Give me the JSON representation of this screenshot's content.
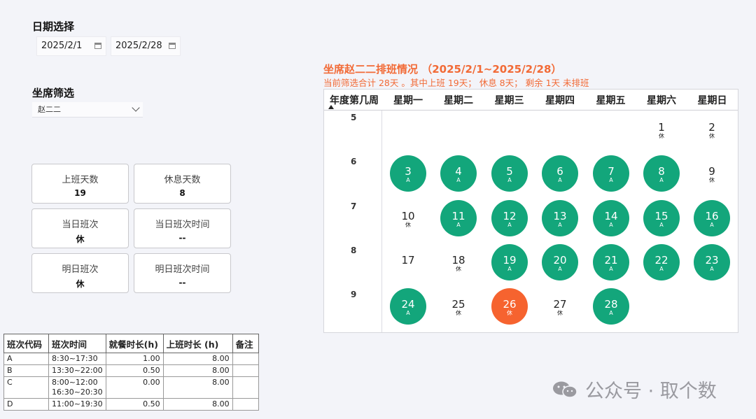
{
  "date_filter": {
    "title": "日期选择",
    "start": "2025/2/1",
    "end": "2025/2/28"
  },
  "seat_filter": {
    "title": "坐席筛选",
    "value": "赵二二"
  },
  "cards": [
    {
      "label": "上班天数",
      "value": "19"
    },
    {
      "label": "休息天数",
      "value": "8"
    },
    {
      "label": "当日班次",
      "value": "休"
    },
    {
      "label": "当日班次时间",
      "value": "--"
    },
    {
      "label": "明日班次",
      "value": "休"
    },
    {
      "label": "明日班次时间",
      "value": "--"
    }
  ],
  "shift_table": {
    "headers": [
      "班次代码",
      "班次时间",
      "就餐时长(h)",
      "上班时长 (h)",
      "备注"
    ],
    "rows": [
      {
        "code": "A",
        "time": "8:30~17:30",
        "meal": "1.00",
        "work": "8.00",
        "note": ""
      },
      {
        "code": "B",
        "time": "13:30~22:00",
        "meal": "0.50",
        "work": "8.00",
        "note": ""
      },
      {
        "code": "C",
        "time": "8:00~12:00",
        "time2": "16:30~20:30",
        "meal": "0.00",
        "work": "8.00",
        "note": ""
      },
      {
        "code": "D",
        "time": "11:00~19:30",
        "meal": "0.50",
        "work": "8.00",
        "note": ""
      }
    ]
  },
  "calendar": {
    "title": "坐席赵二二排班情况 （2025/2/1~2025/2/28）",
    "subtitle": "当前筛选合计 28天 。其中上班 19天； 休息 8天； 剩余 1天 未排班",
    "week_header": "年度第几周",
    "weekdays": [
      "星期一",
      "星期二",
      "星期三",
      "星期四",
      "星期五",
      "星期六",
      "星期日"
    ],
    "colors": {
      "work": "#13a67b",
      "today": "#f6632f",
      "rest": "#ffffff"
    },
    "weeks": [
      {
        "week": "5",
        "days": [
          {
            "day": "",
            "shift": "",
            "type": "empty"
          },
          {
            "day": "",
            "shift": "",
            "type": "empty"
          },
          {
            "day": "",
            "shift": "",
            "type": "empty"
          },
          {
            "day": "",
            "shift": "",
            "type": "empty"
          },
          {
            "day": "",
            "shift": "",
            "type": "empty"
          },
          {
            "day": "1",
            "shift": "休",
            "type": "rest"
          },
          {
            "day": "2",
            "shift": "休",
            "type": "rest"
          }
        ]
      },
      {
        "week": "6",
        "days": [
          {
            "day": "3",
            "shift": "A",
            "type": "work"
          },
          {
            "day": "4",
            "shift": "A",
            "type": "work"
          },
          {
            "day": "5",
            "shift": "A",
            "type": "work"
          },
          {
            "day": "6",
            "shift": "A",
            "type": "work"
          },
          {
            "day": "7",
            "shift": "A",
            "type": "work"
          },
          {
            "day": "8",
            "shift": "A",
            "type": "work"
          },
          {
            "day": "9",
            "shift": "休",
            "type": "rest"
          }
        ]
      },
      {
        "week": "7",
        "days": [
          {
            "day": "10",
            "shift": "休",
            "type": "rest"
          },
          {
            "day": "11",
            "shift": "A",
            "type": "work"
          },
          {
            "day": "12",
            "shift": "A",
            "type": "work"
          },
          {
            "day": "13",
            "shift": "A",
            "type": "work"
          },
          {
            "day": "14",
            "shift": "A",
            "type": "work"
          },
          {
            "day": "15",
            "shift": "A",
            "type": "work"
          },
          {
            "day": "16",
            "shift": "A",
            "type": "work"
          }
        ]
      },
      {
        "week": "8",
        "days": [
          {
            "day": "17",
            "shift": "",
            "type": "rest"
          },
          {
            "day": "18",
            "shift": "休",
            "type": "rest"
          },
          {
            "day": "19",
            "shift": "A",
            "type": "work"
          },
          {
            "day": "20",
            "shift": "A",
            "type": "work"
          },
          {
            "day": "21",
            "shift": "A",
            "type": "work"
          },
          {
            "day": "22",
            "shift": "A",
            "type": "work"
          },
          {
            "day": "23",
            "shift": "A",
            "type": "work"
          }
        ]
      },
      {
        "week": "9",
        "days": [
          {
            "day": "24",
            "shift": "A",
            "type": "work"
          },
          {
            "day": "25",
            "shift": "休",
            "type": "rest"
          },
          {
            "day": "26",
            "shift": "休",
            "type": "today"
          },
          {
            "day": "27",
            "shift": "休",
            "type": "rest"
          },
          {
            "day": "28",
            "shift": "A",
            "type": "work"
          },
          {
            "day": "",
            "shift": "",
            "type": "empty"
          },
          {
            "day": "",
            "shift": "",
            "type": "empty"
          }
        ]
      }
    ]
  },
  "watermark": {
    "text": "公众号 · 取个数",
    "icon": "wechat-icon"
  }
}
